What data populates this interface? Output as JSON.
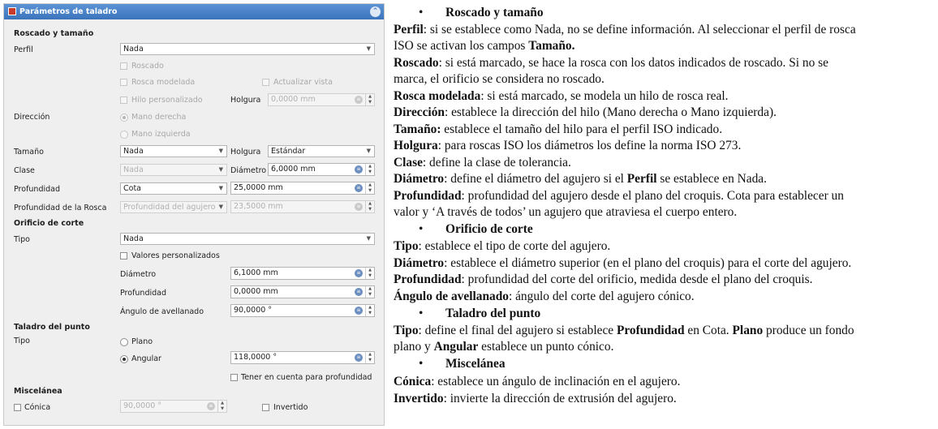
{
  "panel": {
    "title": "Parámetros de taladro",
    "threading": {
      "section": "Roscado y tamaño",
      "profile_label": "Perfil",
      "profile_value": "Nada",
      "threaded": "Roscado",
      "model_thread": "Rosca modelada",
      "update_view": "Actualizar vista",
      "custom_thread": "Hilo personalizado",
      "clearance_label": "Holgura",
      "clearance_value": "0,0000 mm",
      "direction_label": "Dirección",
      "right_hand": "Mano derecha",
      "left_hand": "Mano izquierda",
      "size_label": "Tamaño",
      "size_value": "Nada",
      "clearance2_label": "Holgura",
      "clearance2_value": "Estándar",
      "class_label": "Clase",
      "class_value": "Nada",
      "diameter_label": "Diámetro",
      "diameter_value": "6,0000 mm",
      "depth_label": "Profundidad",
      "depth_type": "Cota",
      "depth_value": "25,0000 mm",
      "thread_depth_label": "Profundidad de la Rosca",
      "thread_depth_type": "Profundidad del agujero",
      "thread_depth_value": "23,5000 mm"
    },
    "cut": {
      "section": "Orificio de corte",
      "type_label": "Tipo",
      "type_value": "Nada",
      "custom_values": "Valores personalizados",
      "diameter_label": "Diámetro",
      "diameter_value": "6,1000 mm",
      "depth_label": "Profundidad",
      "depth_value": "0,0000 mm",
      "countersink_label": "Ángulo de avellanado",
      "countersink_value": "90,0000 °"
    },
    "drill": {
      "section": "Taladro del punto",
      "type_label": "Tipo",
      "flat": "Plano",
      "angled": "Angular",
      "angle_value": "118,0000 °",
      "take_into_account": "Tener en cuenta para profundidad"
    },
    "misc": {
      "section": "Miscelánea",
      "tapered": "Cónica",
      "tapered_value": "90,0000 °",
      "reversed": "Invertido"
    }
  },
  "doc": {
    "h_threading": "Roscado y tamaño",
    "p_perfil_1_b": "Perfil",
    "p_perfil_1": ": si se establece como Nada, no se define información. Al seleccionar el perfil de rosca",
    "p_perfil_2": "ISO se activan los campos ",
    "p_perfil_2_b": "Tamaño.",
    "p_roscado_1_b": "Roscado",
    "p_roscado_1": ": si está marcado, se hace la rosca con los datos indicados de roscado. Si no se",
    "p_roscado_2": "marca, el orificio se considera no roscado.",
    "p_modelada_b": "Rosca modelada",
    "p_modelada": ": si está marcado, se modela un hilo de rosca real.",
    "p_direccion_b": "Dirección",
    "p_direccion": ": establece la dirección del hilo (Mano derecha o Mano izquierda).",
    "p_tamano_b": "Tamaño:",
    "p_tamano": " establece el tamaño del hilo para el perfil ISO indicado.",
    "p_holgura_b": "Holgura",
    "p_holgura": ": para roscas ISO los diámetros los define la norma ISO 273.",
    "p_clase_b": "Clase",
    "p_clase": ": define la clase de tolerancia.",
    "p_diametro_b": "Diámetro",
    "p_diametro": ": define el diámetro del agujero si el ",
    "p_diametro_b2": "Perfil",
    "p_diametro_2": " se establece en Nada.",
    "p_prof_1_b": "Profundidad",
    "p_prof_1": ": profundidad del agujero desde el plano del croquis. Cota para establecer un",
    "p_prof_2": "valor y ‘A través de todos’ un agujero que atraviesa el cuerpo entero.",
    "h_cut": "Orificio de corte",
    "p_tipo_b": "Tipo",
    "p_tipo": ": establece el tipo de corte del agujero.",
    "p_cdiam_b": "Diámetro",
    "p_cdiam": ": establece el diámetro superior (en el plano del croquis) para el corte del agujero.",
    "p_cprof_b": "Profundidad",
    "p_cprof": ": profundidad del corte del orificio, medida desde el plano del croquis.",
    "p_angulo_b": "Ángulo de avellanado",
    "p_angulo": ": ángulo del corte del agujero cónico.",
    "h_drill": "Taladro del punto",
    "p_dtipo_b": "Tipo",
    "p_dtipo_1": ": define el final del agujero si establece ",
    "p_dtipo_b2": "Profundidad",
    "p_dtipo_2": " en Cota.  ",
    "p_dtipo_b3": "Plano",
    "p_dtipo_3": " produce un fondo",
    "p_dtipo_4": "plano y ",
    "p_dtipo_b4": "Angular",
    "p_dtipo_5": " establece un punto cónico.",
    "h_misc": "Miscelánea",
    "p_conica_b": "Cónica",
    "p_conica": ": establece un ángulo de inclinación en el agujero.",
    "p_invertido_b": "Invertido",
    "p_invertido": ": invierte la dirección de extrusión del agujero."
  }
}
